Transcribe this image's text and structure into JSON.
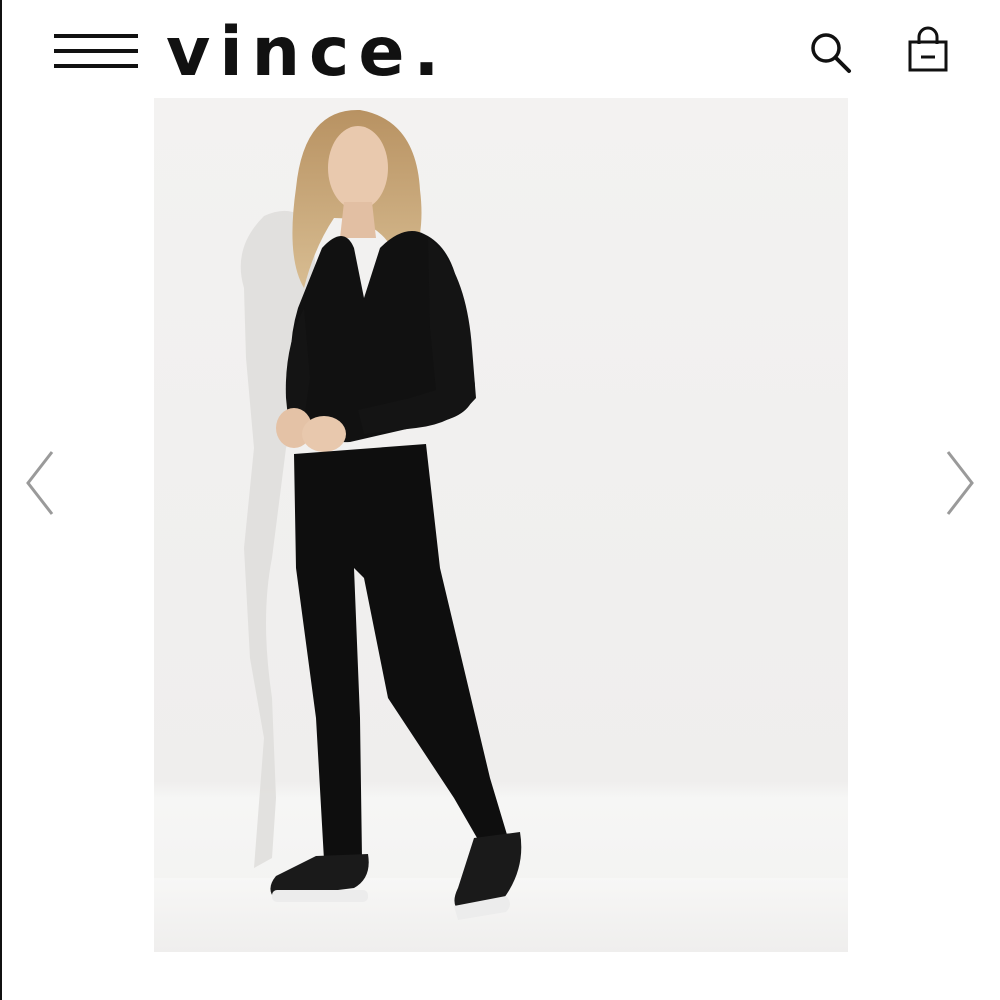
{
  "header": {
    "brand": "vince."
  },
  "icons": {
    "menu": "hamburger-menu-icon",
    "search": "search-icon",
    "bag": "shopping-bag-icon",
    "prev": "chevron-left-icon",
    "next": "chevron-right-icon"
  },
  "colors": {
    "ink": "#111111",
    "arrow": "#9a9a9a",
    "backdrop": "#f1f0ef"
  }
}
